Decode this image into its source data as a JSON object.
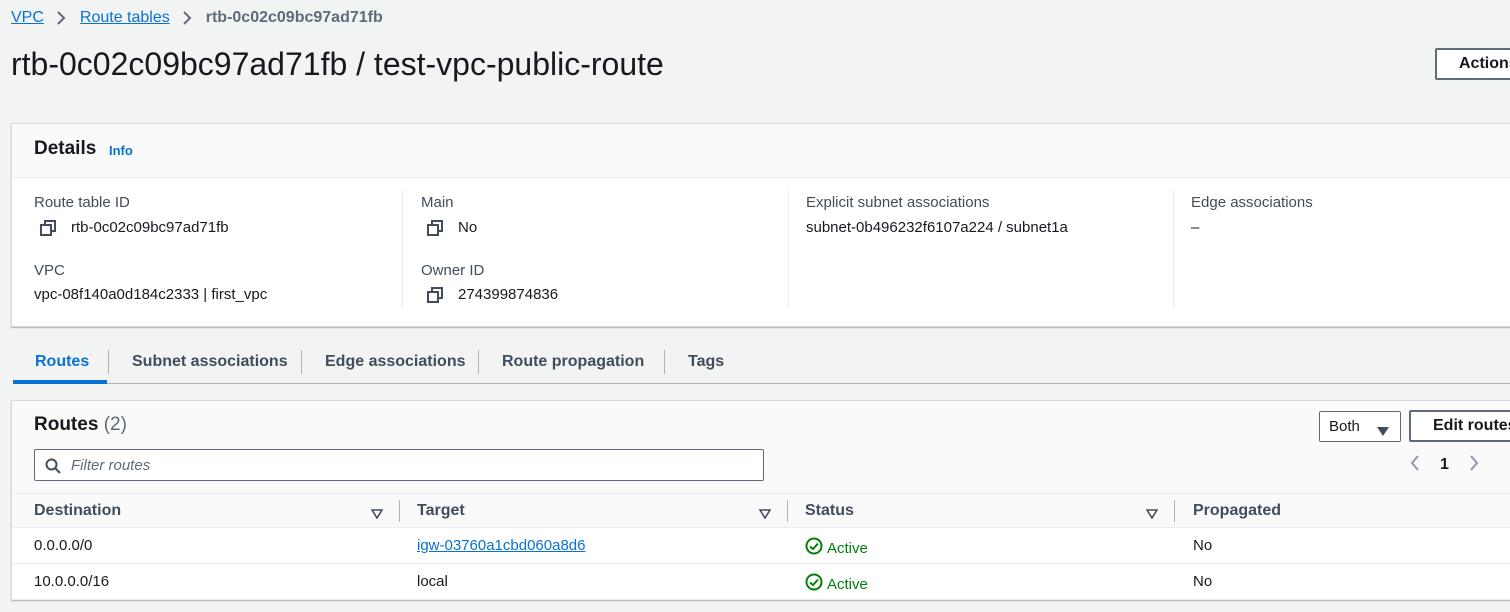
{
  "breadcrumb": {
    "items": [
      "VPC",
      "Route tables"
    ],
    "current": "rtb-0c02c09bc97ad71fb"
  },
  "page_title": "rtb-0c02c09bc97ad71fb / test-vpc-public-route",
  "actions_label": "Actions",
  "details": {
    "title": "Details",
    "info_label": "Info",
    "route_table_id": {
      "label": "Route table ID",
      "value": "rtb-0c02c09bc97ad71fb"
    },
    "vpc": {
      "label": "VPC",
      "value": "vpc-08f140a0d184c2333 | first_vpc"
    },
    "main": {
      "label": "Main",
      "value": "No"
    },
    "owner_id": {
      "label": "Owner ID",
      "value": "274399874836"
    },
    "explicit_subnet": {
      "label": "Explicit subnet associations",
      "value": "subnet-0b496232f6107a224 / subnet1a"
    },
    "edge": {
      "label": "Edge associations",
      "value": "–"
    }
  },
  "tabs": [
    {
      "label": "Routes",
      "active": true
    },
    {
      "label": "Subnet associations"
    },
    {
      "label": "Edge associations"
    },
    {
      "label": "Route propagation"
    },
    {
      "label": "Tags"
    }
  ],
  "routes": {
    "title": "Routes",
    "count": "(2)",
    "filter_select": "Both",
    "edit_label": "Edit routes",
    "filter_placeholder": "Filter routes",
    "page": "1",
    "columns": [
      "Destination",
      "Target",
      "Status",
      "Propagated"
    ],
    "rows": [
      {
        "destination": "0.0.0.0/0",
        "target": "igw-03760a1cbd060a8d6",
        "target_link": true,
        "status": "Active",
        "propagated": "No"
      },
      {
        "destination": "10.0.0.0/16",
        "target": "local",
        "target_link": false,
        "status": "Active",
        "propagated": "No"
      }
    ]
  },
  "colors": {
    "link": "#0972d3",
    "success": "#037f0c",
    "background": "#f2f3f3"
  }
}
